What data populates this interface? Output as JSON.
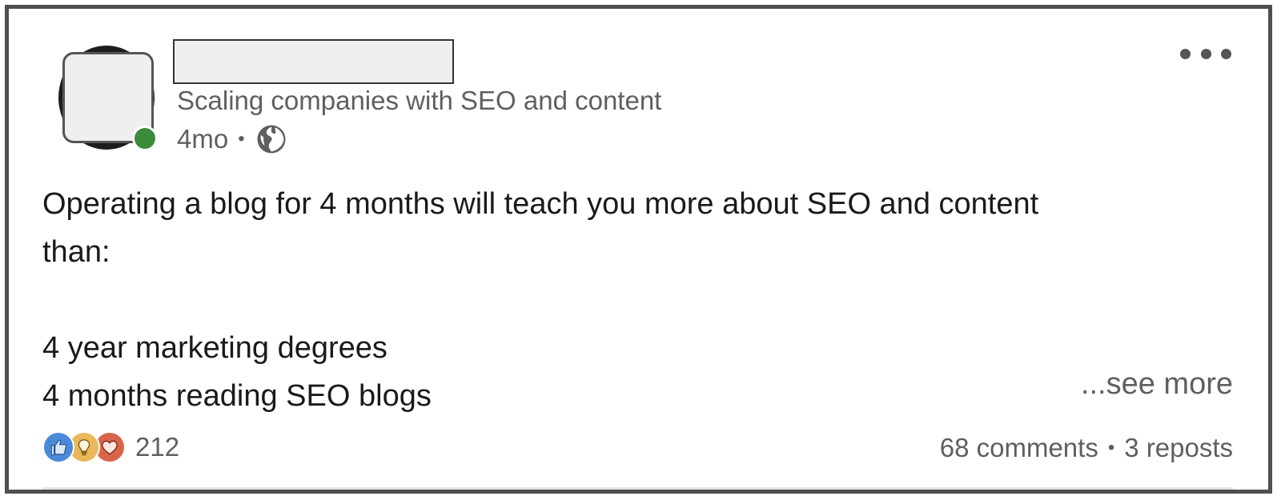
{
  "post": {
    "author_headline": "Scaling companies with SEO and content",
    "timestamp": "4mo",
    "meta_separator": "•",
    "visibility_icon": "globe-icon",
    "body_lines": [
      "Operating a blog for 4 months will teach you more about SEO and content",
      "than:",
      "",
      "4 year marketing degrees",
      "4 months reading SEO blogs"
    ],
    "see_more_label": "...see more",
    "reaction_icons": [
      "like-icon",
      "insightful-icon",
      "love-icon"
    ],
    "reaction_count": "212",
    "comments_label": "68 comments",
    "engage_separator": "•",
    "reposts_label": "3 reposts"
  },
  "colors": {
    "like": "#4a8ad8",
    "insightful": "#e9b85a",
    "love": "#d9644a",
    "online": "#3c8b3c",
    "frame": "#4f4f4f"
  }
}
